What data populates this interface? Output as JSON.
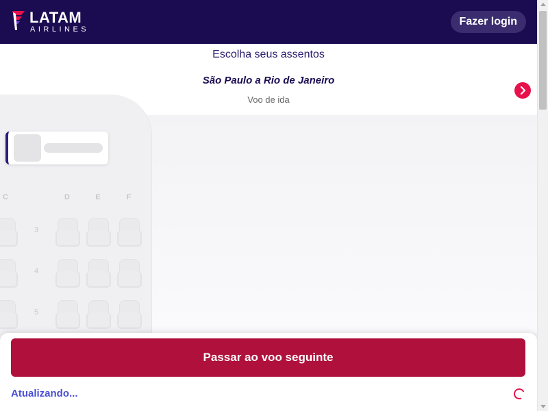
{
  "header": {
    "logo_wordmark": "LATAM",
    "logo_subtext": "AIRLINES",
    "login_label": "Fazer login"
  },
  "flight": {
    "title": "Escolha seus assentos",
    "route": "São Paulo a Rio de Janeiro",
    "leg": "Voo de ida"
  },
  "seatmap": {
    "columns": [
      "C",
      "D",
      "E",
      "F"
    ],
    "rows": [
      "3",
      "4",
      "5"
    ]
  },
  "footer": {
    "next_flight_label": "Passar ao voo seguinte",
    "status_text": "Atualizando..."
  },
  "icons": {
    "next": "chevron-right-icon",
    "loading": "spinner-icon"
  },
  "colors": {
    "header_bg": "#1b0c52",
    "primary_button": "#b0113c",
    "accent": "#e8114b",
    "status_text": "#4a4fd6"
  }
}
